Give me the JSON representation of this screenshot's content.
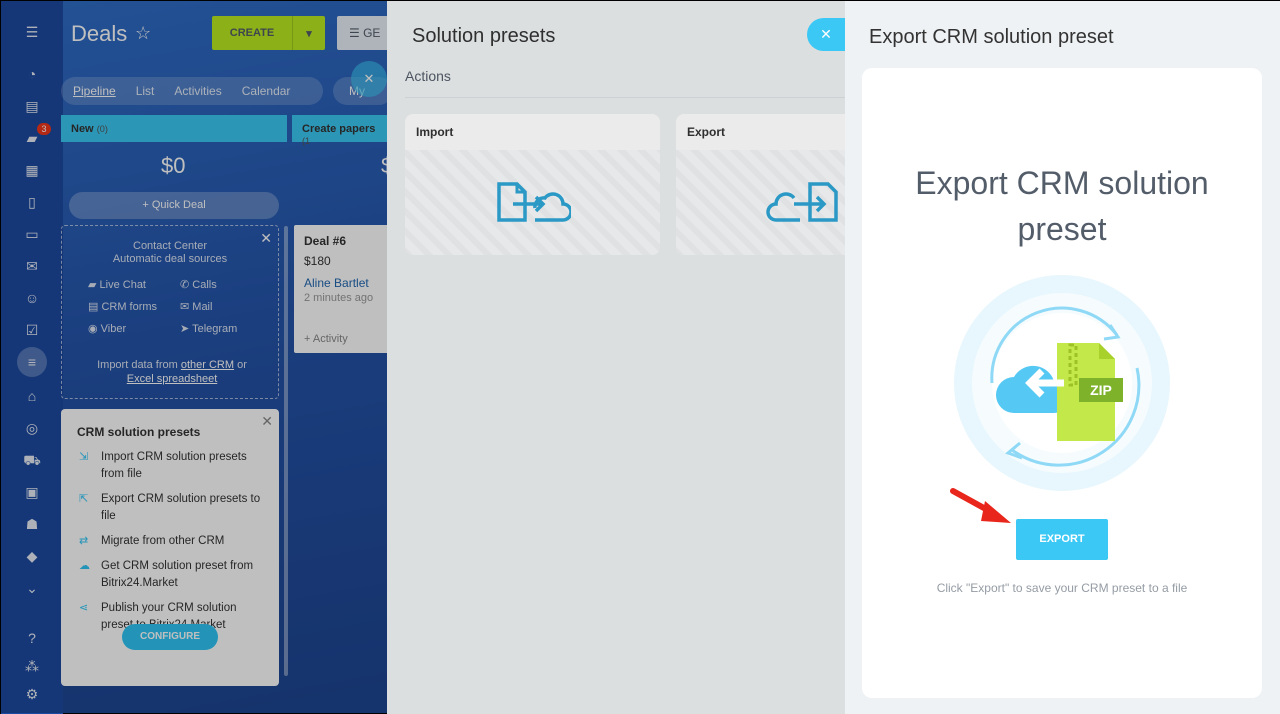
{
  "app": {
    "title": "Deals",
    "create_label": "CREATE",
    "filter_label": "GE",
    "tabs": [
      "Pipeline",
      "List",
      "Activities",
      "Calendar"
    ],
    "tab_extra": "My",
    "notification_count": "3"
  },
  "pipeline": {
    "stages": [
      {
        "name": "New",
        "count": "(0)",
        "amount": "$0"
      },
      {
        "name": "Create papers",
        "count": "(1",
        "amount": "$"
      }
    ],
    "quick_deal": "+ Quick Deal"
  },
  "contact_center": {
    "title_line1": "Contact Center",
    "title_line2": "Automatic deal sources",
    "sources": [
      "Live Chat",
      "Calls",
      "CRM forms",
      "Mail",
      "Viber",
      "Telegram"
    ],
    "import_text": "Import data from",
    "import_link1": "other CRM",
    "import_or": "or",
    "import_link2": "Excel spreadsheet"
  },
  "presets_widget": {
    "title": "CRM solution presets",
    "items": [
      "Import CRM solution presets from file",
      "Export CRM solution presets to file",
      "Migrate from other CRM",
      "Get CRM solution preset from Bitrix24.Market",
      "Publish your CRM solution preset to Bitrix24.Market"
    ],
    "configure_label": "CONFIGURE"
  },
  "deal_card": {
    "name": "Deal #6",
    "amount": "$180",
    "contact": "Aline Bartlet",
    "time": "2 minutes ago",
    "activity": "+ Activity"
  },
  "solution_presets": {
    "title": "Solution presets",
    "section": "Actions",
    "tiles": [
      "Import",
      "Export"
    ]
  },
  "export_panel": {
    "title": "Export CRM solution preset",
    "heading": "Export CRM solution preset",
    "zip_label": "ZIP",
    "button_label": "EXPORT",
    "hint": "Click \"Export\" to save your CRM preset to a file"
  },
  "colors": {
    "accent": "#3bc8f5",
    "create_button": "#bbed21",
    "panel_bg": "#eef2f4",
    "arrow": "#e8261c"
  }
}
